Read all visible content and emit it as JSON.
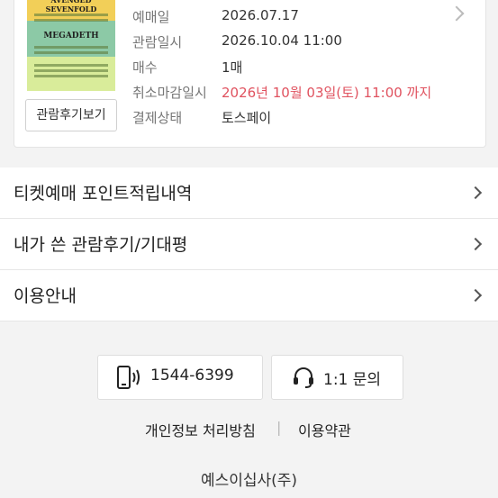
{
  "ticket": {
    "review_button": "관람후기보기",
    "poster_title": "AVENGED SEVENFOLD",
    "poster_band2": "MEGADETH",
    "rows": [
      {
        "key": "예매일",
        "value": "2026.07.17"
      },
      {
        "key": "관람일시",
        "value": "2026.10.04 11:00"
      },
      {
        "key": "매수",
        "value": "1매"
      },
      {
        "key": "취소마감일시",
        "value": "2026년 10월 03일(토) 11:00 까지"
      },
      {
        "key": "결제상태",
        "value": "토스페이"
      }
    ],
    "colors": {
      "cancel_deadline": "#e0525f"
    }
  },
  "menu": [
    {
      "label": "티켓예매 포인트적립내역"
    },
    {
      "label": "내가 쓴 관람후기/기대평"
    },
    {
      "label": "이용안내"
    }
  ],
  "footer": {
    "phone": {
      "label": "1544-6399",
      "icon": "phone-icon"
    },
    "inquiry": {
      "label": "1:1 문의",
      "icon": "headset-icon"
    },
    "privacy": "개인정보 처리방침",
    "divider": "|",
    "terms": "이용약관",
    "company": "예스이십사(주)"
  }
}
